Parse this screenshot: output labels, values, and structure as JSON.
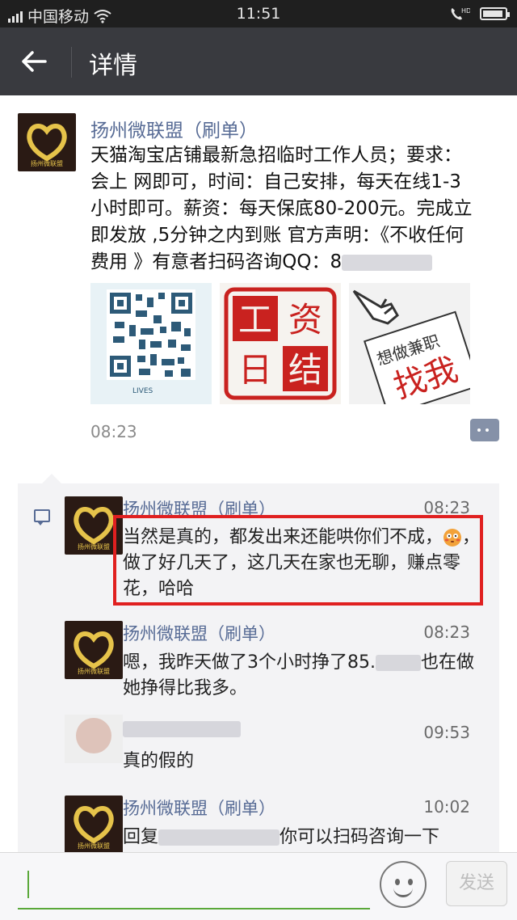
{
  "status_bar": {
    "carrier": "中国移动",
    "time": "11:51",
    "icons": [
      "signal-icon",
      "wifi-icon",
      "hd-call-icon",
      "battery-icon"
    ]
  },
  "title_bar": {
    "back_icon": "back-arrow-icon",
    "title": "详情"
  },
  "post": {
    "author": "扬州微联盟（刷单）",
    "avatar_caption": "扬州微联盟",
    "text_main": "天猫淘宝店铺最新急招临时工作人员；要求：会上 网即可，时间：自己安排，每天在线1-3小时即可。薪资：每天保底80-200元。完成立即发放 ,5分钟之内到账 官方声明：《不收任何费用 》有意者扫码咨询QQ：8",
    "qr_caption": "LIVES",
    "stamp_chars": [
      "工",
      "资",
      "日",
      "结"
    ],
    "poster_text_small": "想做兼职",
    "poster_text_big": "找我",
    "time": "08:23"
  },
  "comments": [
    {
      "name": "扬州微联盟（刷单）",
      "time": "08:23",
      "text_a": "当然是真的，都发出来还能哄你们不成，",
      "text_b": "，做了好几天了，这几天在家也无聊，赚点零花，哈哈",
      "emoji": "flushed-emoji"
    },
    {
      "name": "扬州微联盟（刷单）",
      "time": "08:23",
      "text_a": "嗯，我昨天做了3个小时挣了85.",
      "text_b": "也在做她挣得比我多。"
    },
    {
      "time": "09:53",
      "text": "真的假的"
    },
    {
      "name": "扬州微联盟（刷单）",
      "time": "10:02",
      "text_a": "回复",
      "text_b": "你可以扫码咨询一下"
    }
  ],
  "input_bar": {
    "emoji_icon": "emoji-face-icon",
    "send_label": "发送"
  },
  "colors": {
    "title_bar_bg": "#393a3f",
    "name_link": "#576b95",
    "highlight_box": "#e02020",
    "input_accent": "#5aa83a"
  }
}
